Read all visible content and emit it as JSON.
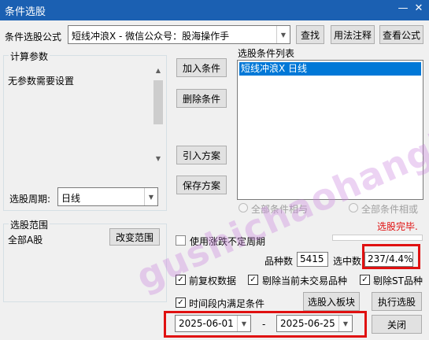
{
  "window": {
    "title": "条件选股",
    "minimize_glyph": "—",
    "close_glyph": "✕"
  },
  "formula": {
    "label": "条件选股公式",
    "value": "短线冲浪X  -  微信公众号：股海操作手",
    "buttons": {
      "find": "查找",
      "usage": "用法注释",
      "view": "查看公式"
    }
  },
  "params": {
    "title": "计算参数",
    "text": "无参数需要设置",
    "period_label": "选股周期:",
    "period_value": "日线"
  },
  "actions": {
    "add": "加入条件",
    "remove": "删除条件",
    "import": "引入方案",
    "save": "保存方案"
  },
  "condition_list": {
    "title": "选股条件列表",
    "items": [
      "短线冲浪X  日线"
    ]
  },
  "combine": {
    "and_label": "全部条件相与",
    "or_label": "全部条件相或"
  },
  "status": {
    "text": "选股完毕.",
    "color": "#e01010"
  },
  "range": {
    "title": "选股范围",
    "value": "全部A股",
    "change_button": "改变范围"
  },
  "options": {
    "volatile_period": "使用涨跌不定周期",
    "pre_adjust": "前复权数据",
    "exclude_non_trading": "剔除当前未交易品种",
    "exclude_st": "剔除ST品种",
    "period_satisfy": "时间段内满足条件",
    "check_glyph": "✓"
  },
  "stats": {
    "count_label": "品种数",
    "count_value": "5415",
    "selected_label": "选中数",
    "selected_value": "237/4.4%"
  },
  "bottom": {
    "to_block_button": "选股入板块",
    "execute_button": "执行选股",
    "date_from": "2025-06-01",
    "date_sep": "-",
    "date_to": "2025-06-25",
    "close_button": "关闭"
  },
  "watermark": "gushichaohanghong.com",
  "colors": {
    "titlebar": "#1b60b2",
    "selection": "#0078d7",
    "highlight_box": "#e01010"
  }
}
